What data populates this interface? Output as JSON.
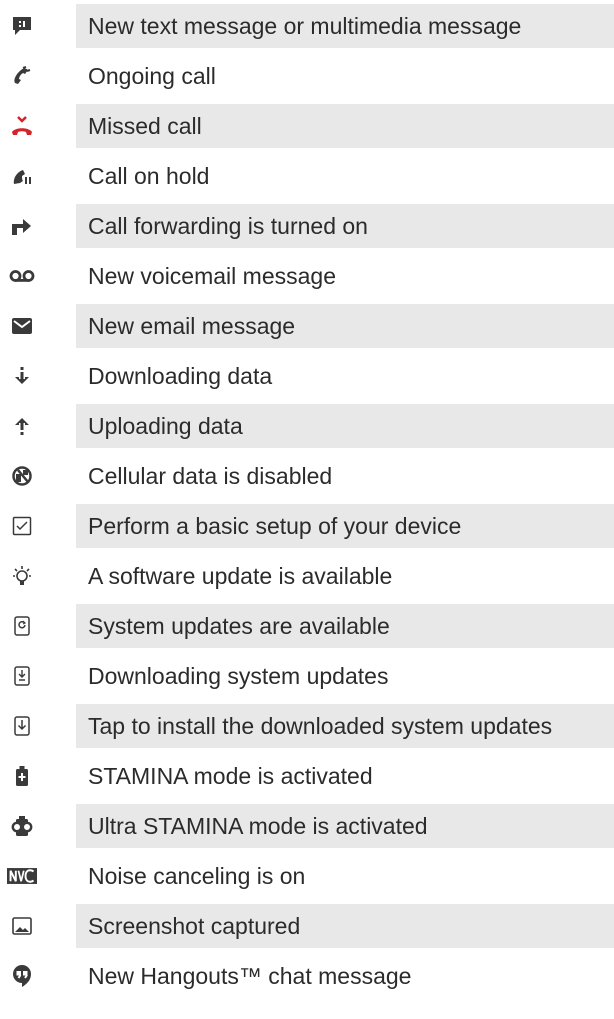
{
  "rows": [
    {
      "icon": "new-message-icon",
      "label": "New text message or multimedia message",
      "shaded": true
    },
    {
      "icon": "ongoing-call-icon",
      "label": "Ongoing call",
      "shaded": false
    },
    {
      "icon": "missed-call-icon",
      "label": "Missed call",
      "shaded": true
    },
    {
      "icon": "call-on-hold-icon",
      "label": "Call on hold",
      "shaded": false
    },
    {
      "icon": "call-forwarding-icon",
      "label": "Call forwarding is turned on",
      "shaded": true
    },
    {
      "icon": "voicemail-icon",
      "label": "New voicemail message",
      "shaded": false
    },
    {
      "icon": "email-icon",
      "label": "New email message",
      "shaded": true
    },
    {
      "icon": "download-icon",
      "label": "Downloading data",
      "shaded": false
    },
    {
      "icon": "upload-icon",
      "label": "Uploading data",
      "shaded": true
    },
    {
      "icon": "cellular-data-disabled-icon",
      "label": "Cellular data is disabled",
      "shaded": false
    },
    {
      "icon": "setup-checkbox-icon",
      "label": "Perform a basic setup of your device",
      "shaded": true
    },
    {
      "icon": "software-update-bulb-icon",
      "label": "A software update is available",
      "shaded": false
    },
    {
      "icon": "system-update-icon",
      "label": "System updates are available",
      "shaded": true
    },
    {
      "icon": "downloading-system-update-icon",
      "label": "Downloading system updates",
      "shaded": false
    },
    {
      "icon": "install-update-icon",
      "label": "Tap to install the downloaded system updates",
      "shaded": true
    },
    {
      "icon": "stamina-icon",
      "label": "STAMINA mode is activated",
      "shaded": false
    },
    {
      "icon": "ultra-stamina-icon",
      "label": "Ultra STAMINA mode is activated",
      "shaded": true
    },
    {
      "icon": "noise-canceling-icon",
      "label": "Noise canceling is on",
      "shaded": false
    },
    {
      "icon": "screenshot-icon",
      "label": "Screenshot captured",
      "shaded": true
    },
    {
      "icon": "hangouts-icon",
      "label": "New Hangouts™ chat message",
      "shaded": false
    }
  ],
  "colors": {
    "icon": "#3a3a3a",
    "missed_call": "#d4232b",
    "row_shade": "#e8e8e8",
    "text": "#2b2b2b"
  }
}
